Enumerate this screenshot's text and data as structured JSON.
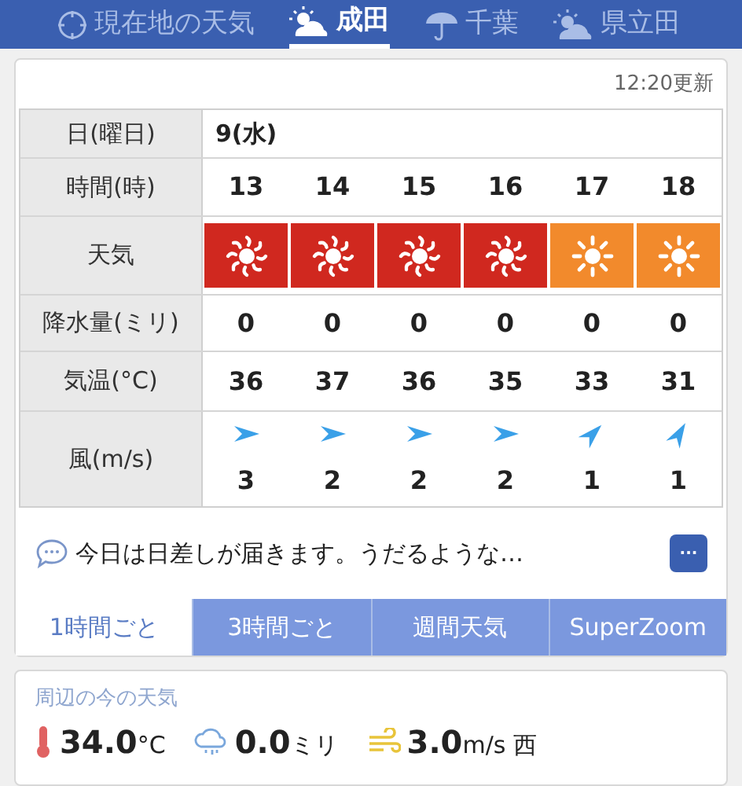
{
  "location_tabs": [
    {
      "label": "現在地の天気",
      "kind": "locate",
      "selected": false
    },
    {
      "label": "成田",
      "kind": "sun_cloud",
      "selected": true
    },
    {
      "label": "千葉",
      "kind": "umbrella",
      "selected": false
    },
    {
      "label": "県立田",
      "kind": "sun_cloud",
      "selected": false
    }
  ],
  "forecast": {
    "updated": "12:20更新",
    "date_label": "日(曜日)",
    "date": "9(水)",
    "time_label": "時間(時)",
    "weather_label": "天気",
    "precip_label": "降水量(ミリ)",
    "temp_label": "気温(°C)",
    "wind_label": "風(m/s)",
    "hours": [
      {
        "time": "13",
        "weather": {
          "kind": "hot",
          "color": "#d0281f"
        },
        "precip": "0",
        "temp": "36",
        "wind": {
          "kind": "west",
          "speed": "3"
        }
      },
      {
        "time": "14",
        "weather": {
          "kind": "hot",
          "color": "#d0281f"
        },
        "precip": "0",
        "temp": "37",
        "wind": {
          "kind": "west",
          "speed": "2"
        }
      },
      {
        "time": "15",
        "weather": {
          "kind": "hot",
          "color": "#d0281f"
        },
        "precip": "0",
        "temp": "36",
        "wind": {
          "kind": "west",
          "speed": "2"
        }
      },
      {
        "time": "16",
        "weather": {
          "kind": "hot",
          "color": "#d0281f"
        },
        "precip": "0",
        "temp": "35",
        "wind": {
          "kind": "west",
          "speed": "2"
        }
      },
      {
        "time": "17",
        "weather": {
          "kind": "sunny",
          "color": "#f28a2c"
        },
        "precip": "0",
        "temp": "33",
        "wind": {
          "kind": "southwest",
          "speed": "1"
        }
      },
      {
        "time": "18",
        "weather": {
          "kind": "sunny",
          "color": "#f28a2c"
        },
        "precip": "0",
        "temp": "31",
        "wind": {
          "kind": "southsouthwest",
          "speed": "1"
        }
      }
    ],
    "comment": "今日は日差しが届きます。うだるような…",
    "more_button": "···",
    "view_tabs": [
      {
        "label": "1時間ごと",
        "selected": true
      },
      {
        "label": "3時間ごと",
        "selected": false
      },
      {
        "label": "週間天気",
        "selected": false
      },
      {
        "label": "SuperZoom",
        "selected": false
      }
    ]
  },
  "nearby": {
    "title": "周辺の今の天気",
    "temperature": "34.0",
    "temperature_unit": "°C",
    "rain": "0.0",
    "rain_unit": "ミリ",
    "wind": "3.0",
    "wind_unit": "m/s 西"
  }
}
